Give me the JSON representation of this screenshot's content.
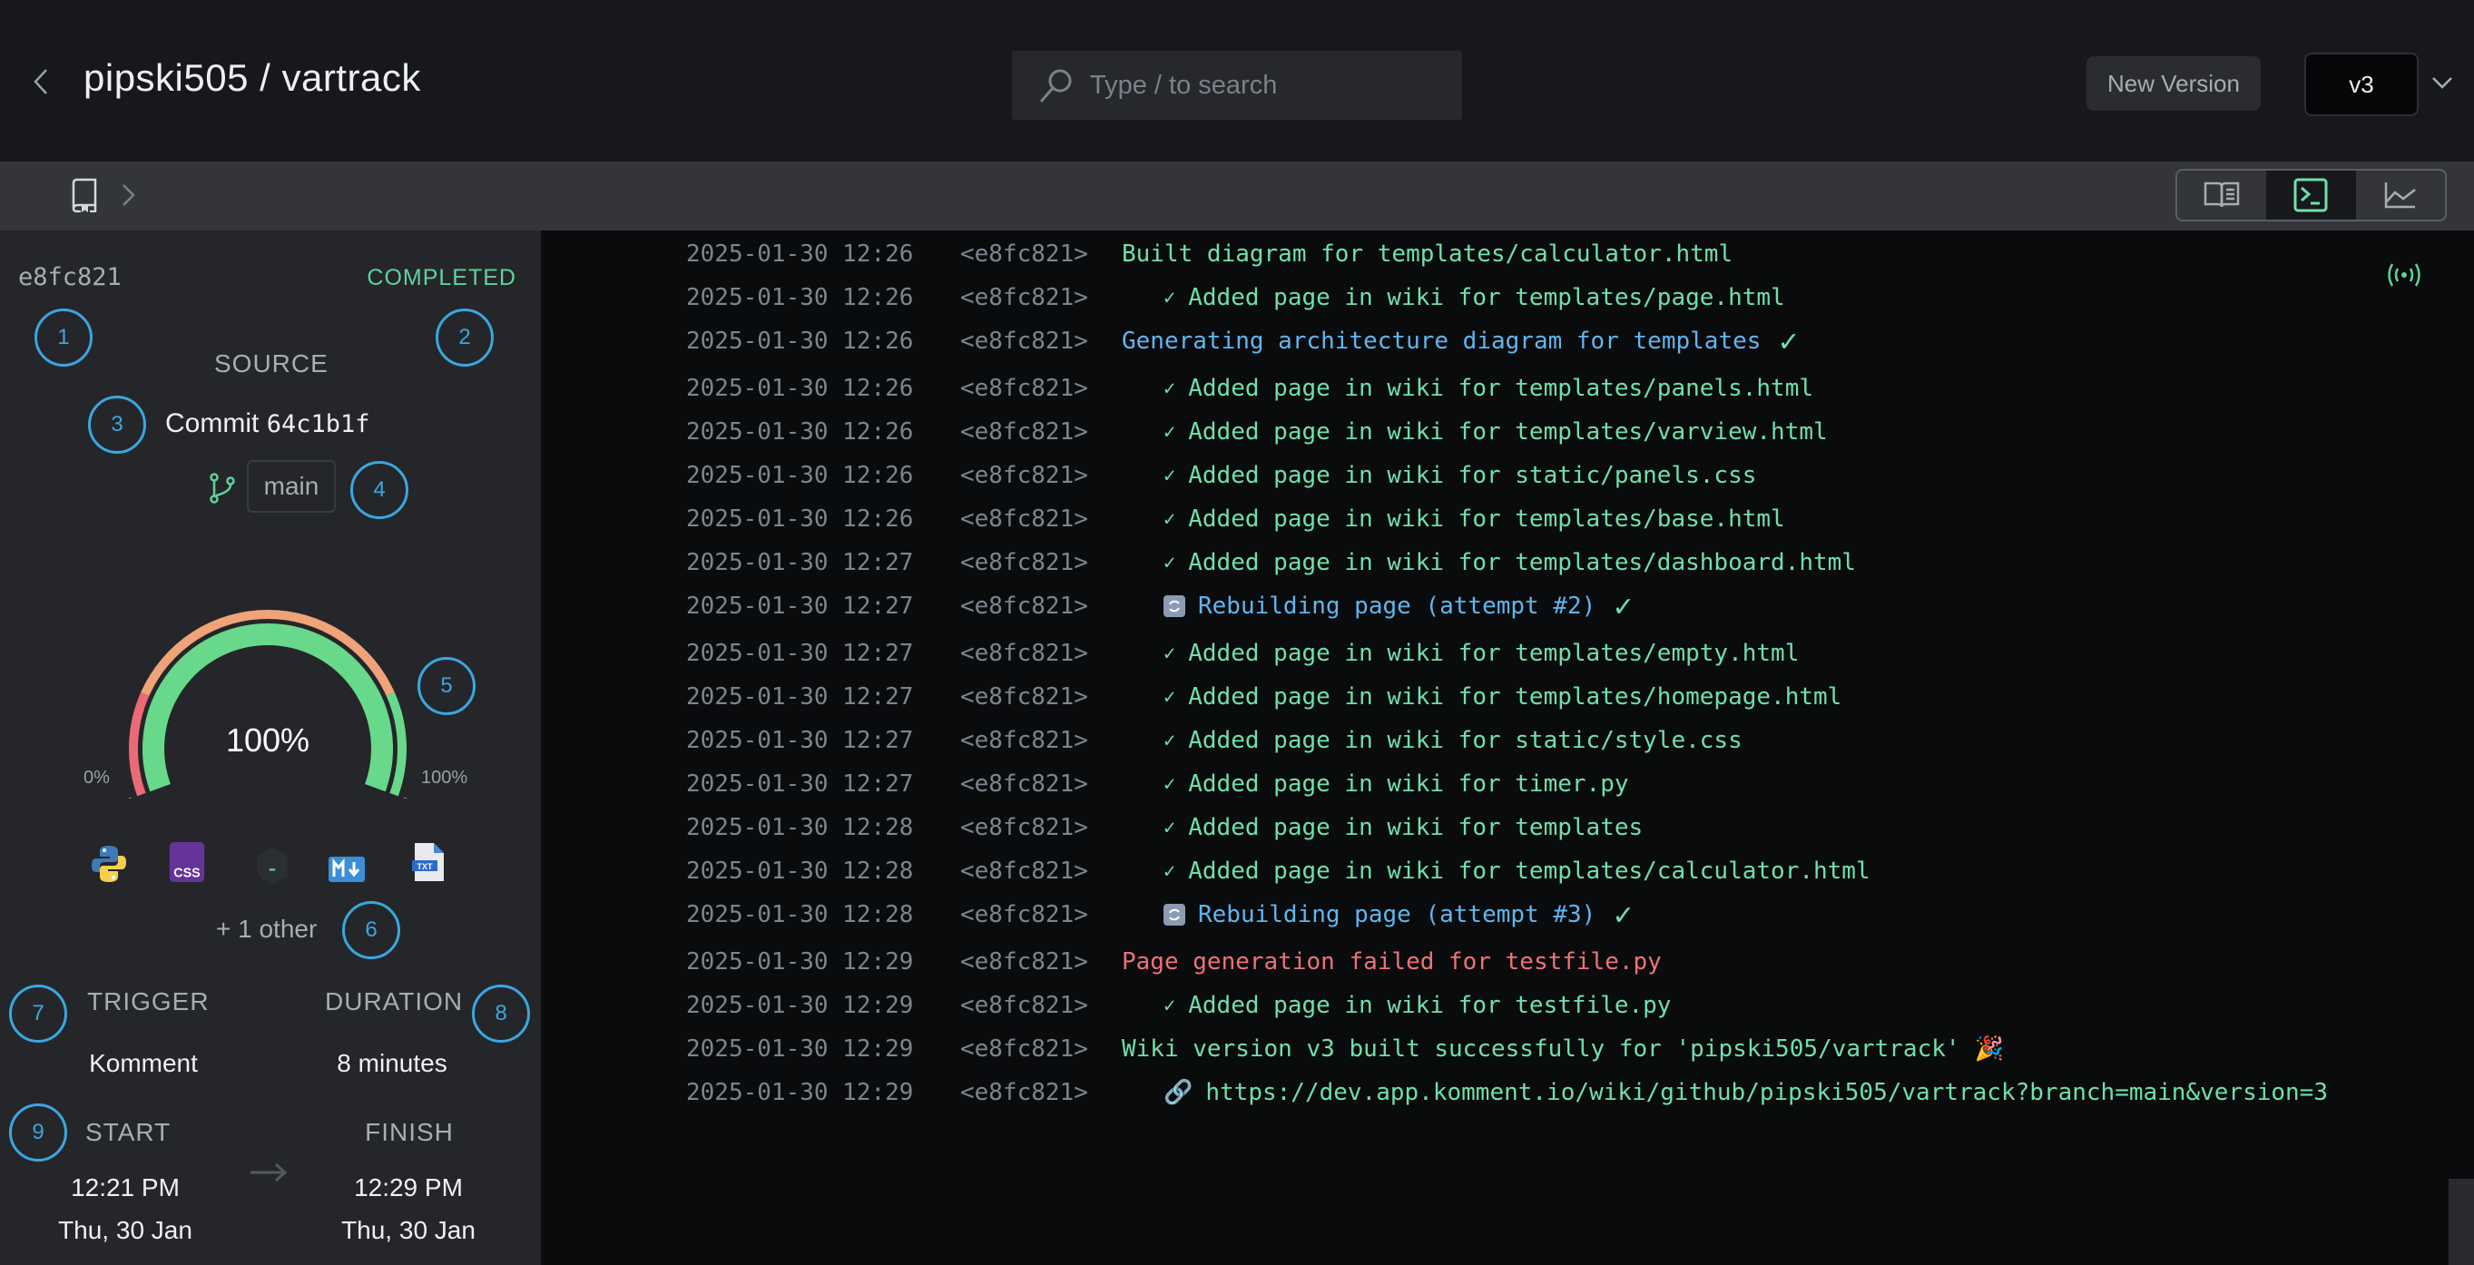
{
  "header": {
    "title": "pipski505 / vartrack",
    "search_placeholder": "Type / to search",
    "new_version_label": "New Version",
    "version_selected": "v3"
  },
  "toolbar": {
    "views": [
      {
        "name": "docs-view",
        "icon": "book-open-icon",
        "active": false
      },
      {
        "name": "terminal-view",
        "icon": "terminal-icon",
        "active": true
      },
      {
        "name": "chart-view",
        "icon": "line-chart-icon",
        "active": false
      }
    ]
  },
  "run": {
    "id": "e8fc821",
    "status": "COMPLETED",
    "status_color": "#5ed39a",
    "source_label": "SOURCE",
    "commit_prefix": "Commit",
    "commit_hash": "64c1b1f",
    "branch": "main",
    "progress_percent": 100,
    "progress_label": "100%",
    "gauge_min_label": "0%",
    "gauge_max_label": "100%",
    "languages": [
      "python-icon",
      "css-icon",
      "shell-icon",
      "markdown-icon",
      "txt-file-icon"
    ],
    "other_label": "+ 1 other",
    "trigger_label": "TRIGGER",
    "trigger_value": "Komment",
    "duration_label": "DURATION",
    "duration_value": "8 minutes",
    "start_label": "START",
    "start_time": "12:21 PM",
    "start_date": "Thu, 30 Jan",
    "finish_label": "FINISH",
    "finish_time": "12:29 PM",
    "finish_date": "Thu, 30 Jan"
  },
  "annotations": [
    "1",
    "2",
    "3",
    "4",
    "5",
    "6",
    "7",
    "8",
    "9"
  ],
  "log": [
    {
      "ts": "2025-01-30 12:26",
      "id": "<e8fc821>",
      "type": "green",
      "text": "Built diagram for templates/calculator.html"
    },
    {
      "ts": "2025-01-30 12:26",
      "id": "<e8fc821>",
      "type": "added",
      "text": "Added page in wiki for templates/page.html"
    },
    {
      "ts": "2025-01-30 12:26",
      "id": "<e8fc821>",
      "type": "blue-check",
      "text": "Generating architecture diagram for templates"
    },
    {
      "ts": "2025-01-30 12:26",
      "id": "<e8fc821>",
      "type": "added",
      "text": "Added page in wiki for templates/panels.html"
    },
    {
      "ts": "2025-01-30 12:26",
      "id": "<e8fc821>",
      "type": "added",
      "text": "Added page in wiki for templates/varview.html"
    },
    {
      "ts": "2025-01-30 12:26",
      "id": "<e8fc821>",
      "type": "added",
      "text": "Added page in wiki for static/panels.css"
    },
    {
      "ts": "2025-01-30 12:26",
      "id": "<e8fc821>",
      "type": "added",
      "text": "Added page in wiki for templates/base.html"
    },
    {
      "ts": "2025-01-30 12:27",
      "id": "<e8fc821>",
      "type": "added",
      "text": "Added page in wiki for templates/dashboard.html"
    },
    {
      "ts": "2025-01-30 12:27",
      "id": "<e8fc821>",
      "type": "rebuild",
      "text": "Rebuilding page (attempt #2)"
    },
    {
      "ts": "2025-01-30 12:27",
      "id": "<e8fc821>",
      "type": "added",
      "text": "Added page in wiki for templates/empty.html"
    },
    {
      "ts": "2025-01-30 12:27",
      "id": "<e8fc821>",
      "type": "added",
      "text": "Added page in wiki for templates/homepage.html"
    },
    {
      "ts": "2025-01-30 12:27",
      "id": "<e8fc821>",
      "type": "added",
      "text": "Added page in wiki for static/style.css"
    },
    {
      "ts": "2025-01-30 12:27",
      "id": "<e8fc821>",
      "type": "added",
      "text": "Added page in wiki for timer.py"
    },
    {
      "ts": "2025-01-30 12:28",
      "id": "<e8fc821>",
      "type": "added",
      "text": "Added page in wiki for templates"
    },
    {
      "ts": "2025-01-30 12:28",
      "id": "<e8fc821>",
      "type": "added",
      "text": "Added page in wiki for templates/calculator.html"
    },
    {
      "ts": "2025-01-30 12:28",
      "id": "<e8fc821>",
      "type": "rebuild",
      "text": "Rebuilding page (attempt #3)"
    },
    {
      "ts": "2025-01-30 12:29",
      "id": "<e8fc821>",
      "type": "red",
      "text": "Page generation failed for testfile.py"
    },
    {
      "ts": "2025-01-30 12:29",
      "id": "<e8fc821>",
      "type": "added",
      "text": "Added page in wiki for testfile.py"
    },
    {
      "ts": "2025-01-30 12:29",
      "id": "<e8fc821>",
      "type": "success",
      "text": "Wiki version v3 built successfully for 'pipski505/vartrack'"
    },
    {
      "ts": "2025-01-30 12:29",
      "id": "<e8fc821>",
      "type": "link",
      "text": "https://dev.app.komment.io/wiki/github/pipski505/vartrack?branch=main&version=3"
    }
  ],
  "colors": {
    "green": "#6fe0ab",
    "blue": "#5fb6ef",
    "red": "#f07178",
    "annotation": "#3aa7e0",
    "gauge_outer_red": "#ec6a78",
    "gauge_outer_orange": "#f0a378",
    "gauge_outer_green": "#68d98a",
    "gauge_inner": "#68d98a"
  }
}
